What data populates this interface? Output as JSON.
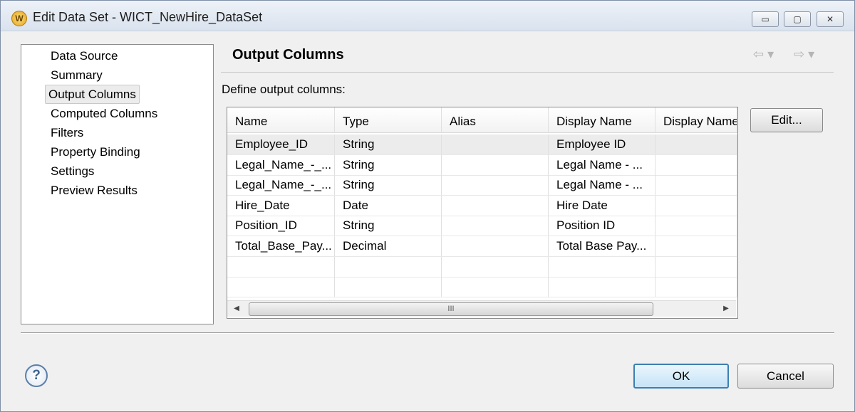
{
  "window": {
    "title": "Edit Data Set - WICT_NewHire_DataSet",
    "app_icon_letter": "W"
  },
  "window_controls": {
    "minimize": "▭",
    "maximize": "▢",
    "close": "✕"
  },
  "nav": {
    "items": [
      {
        "label": "Data Source"
      },
      {
        "label": "Summary"
      },
      {
        "label": "Output Columns",
        "selected": true
      },
      {
        "label": "Computed Columns"
      },
      {
        "label": "Filters"
      },
      {
        "label": "Property Binding"
      },
      {
        "label": "Settings"
      },
      {
        "label": "Preview Results"
      }
    ]
  },
  "page": {
    "title": "Output Columns",
    "subtitle": "Define output columns:",
    "back_icon": "⇦ ▾",
    "forward_icon": "⇨ ▾"
  },
  "table": {
    "columns": [
      "Name",
      "Type",
      "Alias",
      "Display Name",
      "Display Name"
    ],
    "rows": [
      [
        "Employee_ID",
        "String",
        "",
        "Employee ID",
        ""
      ],
      [
        "Legal_Name_-_...",
        "String",
        "",
        "Legal Name - ...",
        ""
      ],
      [
        "Legal_Name_-_...",
        "String",
        "",
        "Legal Name - ...",
        ""
      ],
      [
        "Hire_Date",
        "Date",
        "",
        "Hire Date",
        ""
      ],
      [
        "Position_ID",
        "String",
        "",
        "Position ID",
        ""
      ],
      [
        "Total_Base_Pay...",
        "Decimal",
        "",
        "Total Base Pay...",
        ""
      ],
      [
        "",
        "",
        "",
        "",
        ""
      ],
      [
        "",
        "",
        "",
        "",
        ""
      ]
    ],
    "scroll_left": "◀",
    "scroll_right": "▶",
    "scroll_grip": "III"
  },
  "buttons": {
    "edit": "Edit...",
    "ok": "OK",
    "cancel": "Cancel",
    "help": "?"
  },
  "colors": {
    "default_button_border": "#3c7fb1",
    "selection": "#ececec"
  }
}
